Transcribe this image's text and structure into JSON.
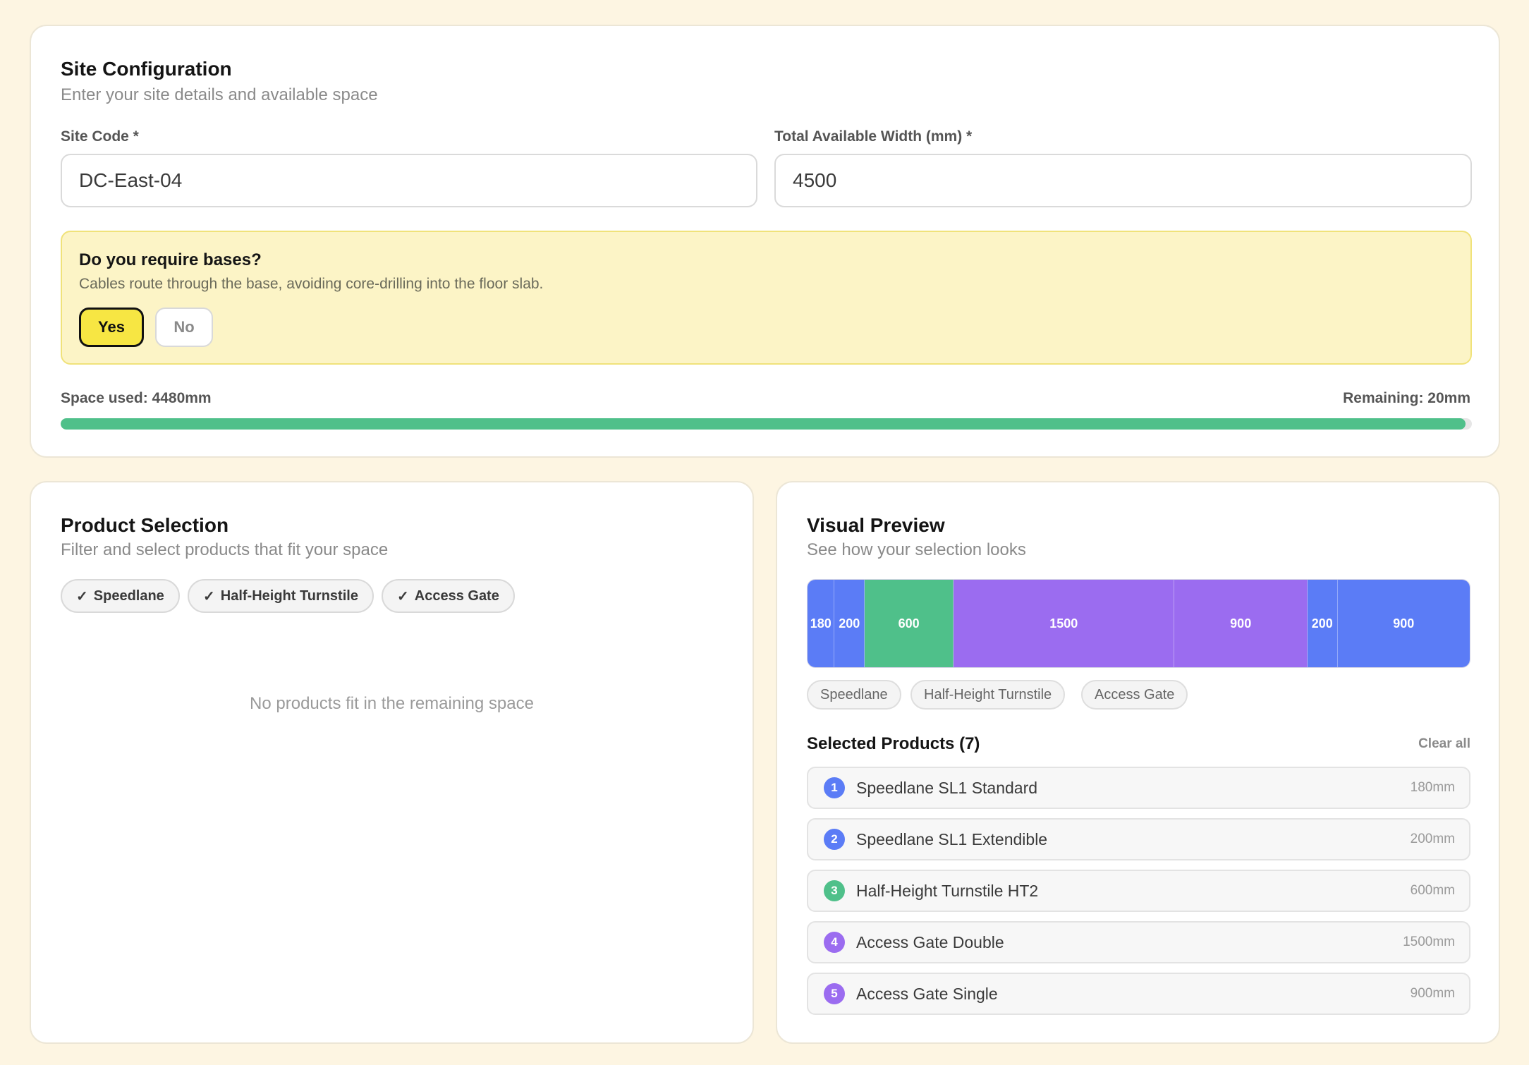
{
  "site_config": {
    "title": "Site Configuration",
    "subtitle": "Enter your site details and available space",
    "site_code_label": "Site Code *",
    "site_code_value": "DC-East-04",
    "width_label": "Total Available Width (mm) *",
    "width_value": "4500",
    "bases": {
      "question": "Do you require bases?",
      "description": "Cables route through the base, avoiding core-drilling into the floor slab.",
      "yes_label": "Yes",
      "no_label": "No",
      "selected": "Yes"
    },
    "space_used_label": "Space used: 4480mm",
    "remaining_label": "Remaining: 20mm",
    "space_used_mm": 4480,
    "total_mm": 4500,
    "progress_color": "#4fc08a"
  },
  "product_selection": {
    "title": "Product Selection",
    "subtitle": "Filter and select products that fit your space",
    "filters": [
      {
        "check": "✓",
        "label": "Speedlane"
      },
      {
        "check": "✓",
        "label": "Half-Height Turnstile"
      },
      {
        "check": "✓",
        "label": "Access Gate"
      }
    ],
    "empty_message": "No products fit in the remaining space"
  },
  "visual_preview": {
    "title": "Visual Preview",
    "subtitle": "See how your selection looks",
    "segments": [
      {
        "label": "180",
        "width_mm": 180,
        "color": "#5b7cf6"
      },
      {
        "label": "200",
        "width_mm": 200,
        "color": "#5b7cf6"
      },
      {
        "label": "600",
        "width_mm": 600,
        "color": "#4fc08a"
      },
      {
        "label": "1500",
        "width_mm": 1500,
        "color": "#9b6cf0"
      },
      {
        "label": "900",
        "width_mm": 900,
        "color": "#9b6cf0"
      },
      {
        "label": "200",
        "width_mm": 200,
        "color": "#5b7cf6"
      },
      {
        "label": "900",
        "width_mm": 900,
        "color": "#5b7cf6"
      }
    ],
    "legend": [
      "Speedlane",
      "Half-Height Turnstile",
      "Access Gate"
    ],
    "selected_title": "Selected Products (7)",
    "clear_all_label": "Clear all",
    "selected_products": [
      {
        "num": "1",
        "name": "Speedlane SL1 Standard",
        "width": "180mm",
        "color": "#5b7cf6"
      },
      {
        "num": "2",
        "name": "Speedlane SL1 Extendible",
        "width": "200mm",
        "color": "#5b7cf6"
      },
      {
        "num": "3",
        "name": "Half-Height Turnstile HT2",
        "width": "600mm",
        "color": "#4fc08a"
      },
      {
        "num": "4",
        "name": "Access Gate Double",
        "width": "1500mm",
        "color": "#9b6cf0"
      },
      {
        "num": "5",
        "name": "Access Gate Single",
        "width": "900mm",
        "color": "#9b6cf0"
      }
    ]
  }
}
